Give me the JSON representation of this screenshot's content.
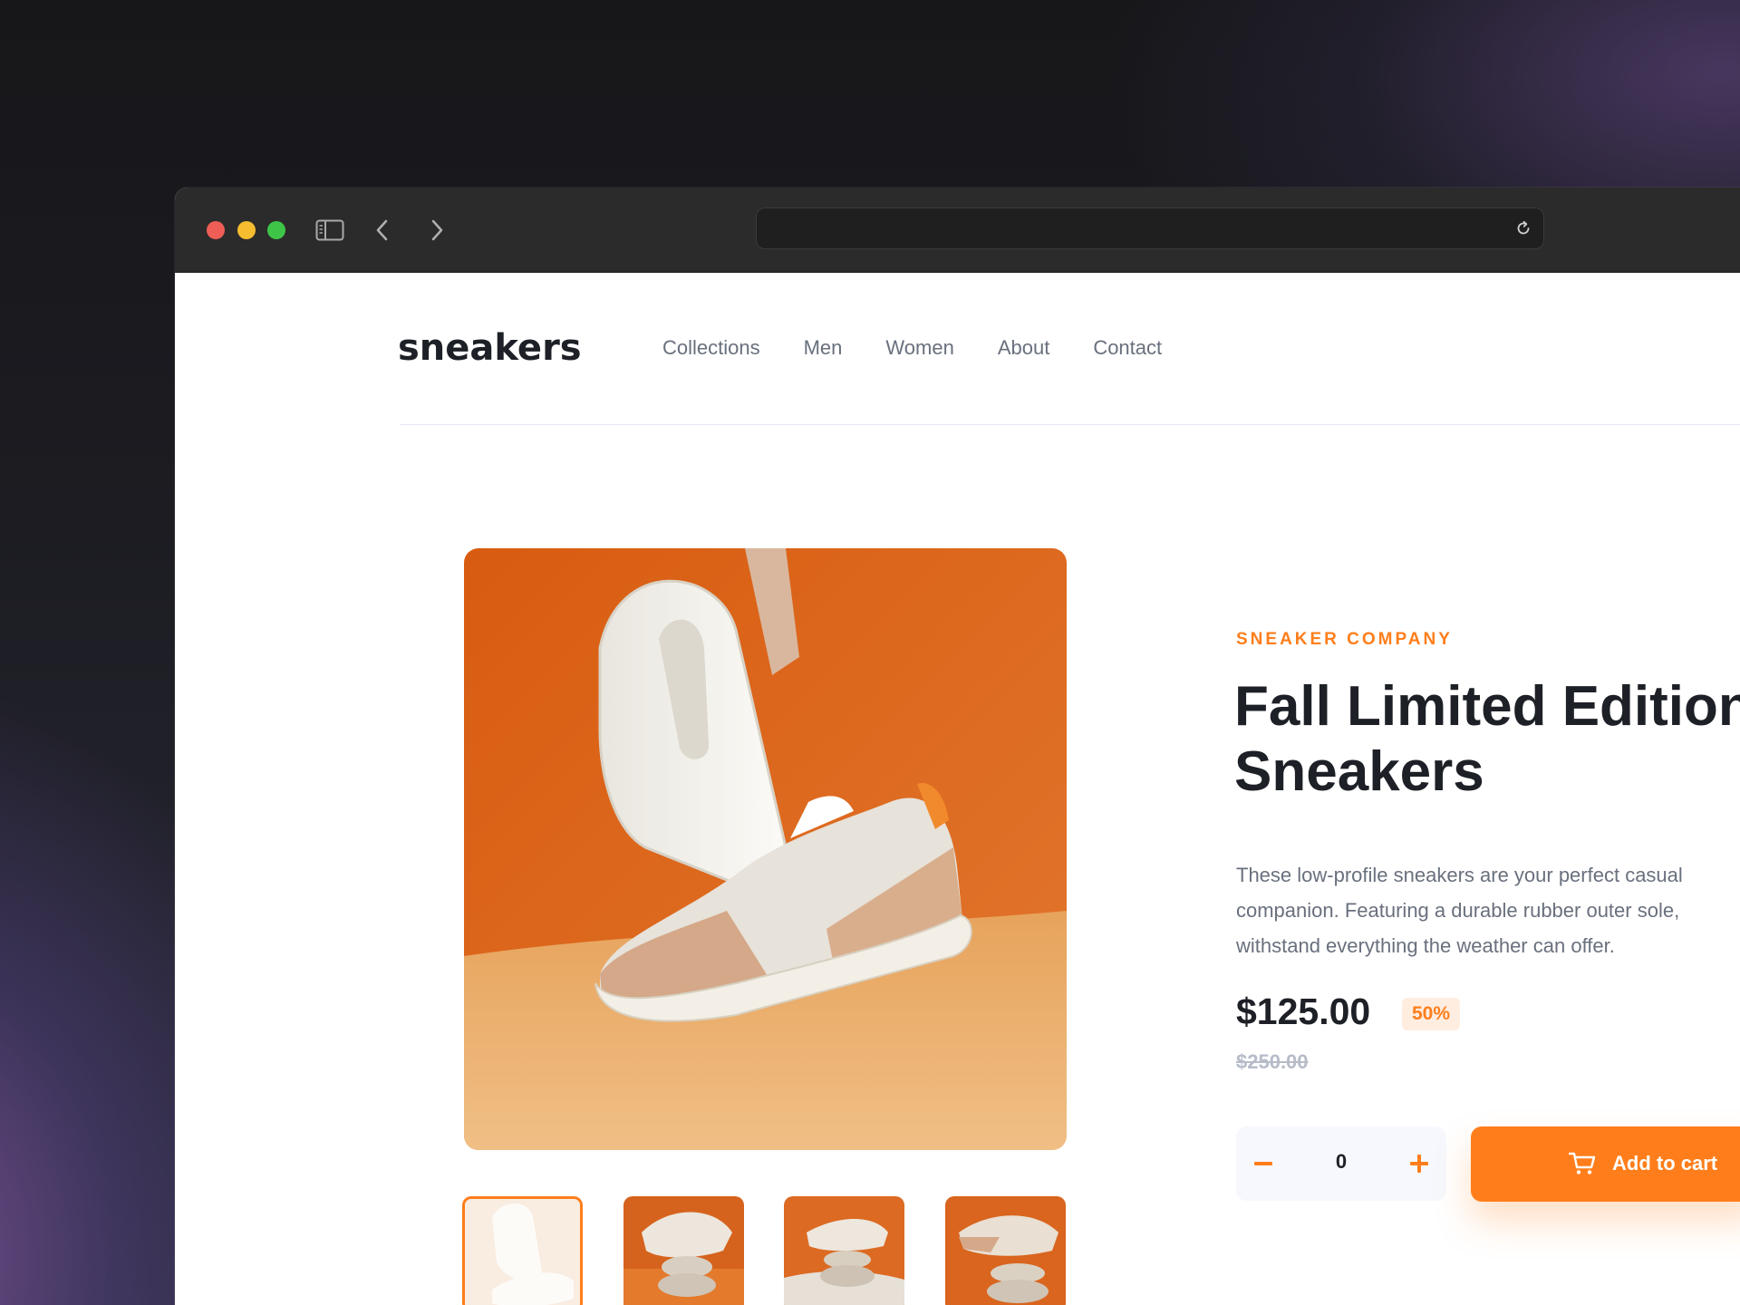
{
  "browser": {
    "address": "",
    "icons": {
      "sidebar": "sidebar-icon",
      "back": "chevron-left-icon",
      "forward": "chevron-right-icon",
      "reload": "reload-icon"
    }
  },
  "site": {
    "logo": "sneakers",
    "nav": [
      "Collections",
      "Men",
      "Women",
      "About",
      "Contact"
    ]
  },
  "product": {
    "company": "SNEAKER COMPANY",
    "title": "Fall Limited Edition\nSneakers",
    "description": "These low-profile sneakers are your perfect casual\ncompanion. Featuring a durable rubber outer sole,\nwithstand everything the weather can offer.",
    "price": "$125.00",
    "discount": "50%",
    "original_price": "$250.00",
    "quantity": "0",
    "add_to_cart": "Add to cart",
    "thumbnails_count": 4,
    "active_thumbnail": 1
  },
  "colors": {
    "accent": "#ff7e1b",
    "accent_light": "#ffede0",
    "text_dark": "#1d2026",
    "text_muted": "#69707d"
  }
}
